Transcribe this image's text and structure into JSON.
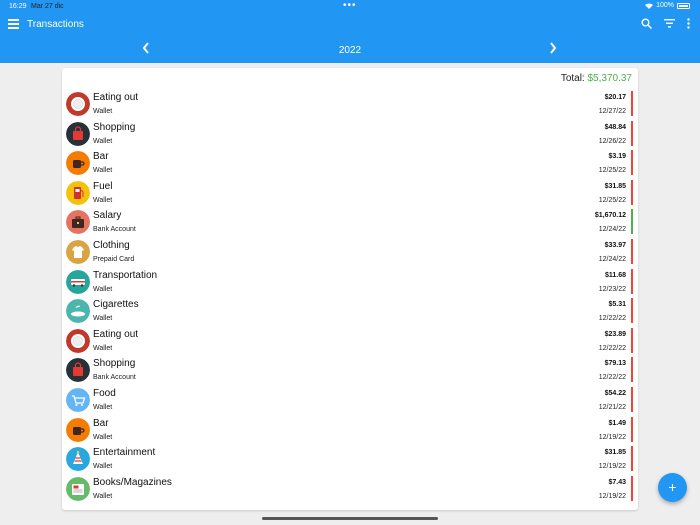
{
  "status": {
    "time": "16:29",
    "date": "Mar 27 dic",
    "battery": "100%"
  },
  "appbar": {
    "title": "Transactions"
  },
  "year": "2022",
  "total": {
    "label": "Total:",
    "amount": "$5,370.37"
  },
  "colors": {
    "primary": "#2196f3",
    "expense": "#f44336",
    "income": "#4caf50"
  },
  "transactions": [
    {
      "category": "Eating out",
      "account": "Wallet",
      "amount": "$20.17",
      "date": "12/27/22",
      "type": "expense",
      "icon": "plate-icon",
      "icon_color": "#c0392b"
    },
    {
      "category": "Shopping",
      "account": "Wallet",
      "amount": "$48.84",
      "date": "12/26/22",
      "type": "expense",
      "icon": "shopping-bag-icon",
      "icon_color": "#263238"
    },
    {
      "category": "Bar",
      "account": "Wallet",
      "amount": "$3.19",
      "date": "12/25/22",
      "type": "expense",
      "icon": "coffee-cup-icon",
      "icon_color": "#f57c00"
    },
    {
      "category": "Fuel",
      "account": "Wallet",
      "amount": "$31.85",
      "date": "12/25/22",
      "type": "expense",
      "icon": "fuel-pump-icon",
      "icon_color": "#f4c20d"
    },
    {
      "category": "Salary",
      "account": "Bank Account",
      "amount": "$1,670.12",
      "date": "12/24/22",
      "type": "income",
      "icon": "briefcase-icon",
      "icon_color": "#e5735f"
    },
    {
      "category": "Clothing",
      "account": "Prepaid Card",
      "amount": "$33.97",
      "date": "12/24/22",
      "type": "expense",
      "icon": "shirt-icon",
      "icon_color": "#d9a441"
    },
    {
      "category": "Transportation",
      "account": "Wallet",
      "amount": "$11.68",
      "date": "12/23/22",
      "type": "expense",
      "icon": "bus-icon",
      "icon_color": "#26a69a"
    },
    {
      "category": "Cigarettes",
      "account": "Wallet",
      "amount": "$5.31",
      "date": "12/22/22",
      "type": "expense",
      "icon": "ashtray-icon",
      "icon_color": "#4db6ac"
    },
    {
      "category": "Eating out",
      "account": "Wallet",
      "amount": "$23.89",
      "date": "12/22/22",
      "type": "expense",
      "icon": "plate-icon",
      "icon_color": "#c0392b"
    },
    {
      "category": "Shopping",
      "account": "Bank Account",
      "amount": "$79.13",
      "date": "12/22/22",
      "type": "expense",
      "icon": "shopping-bag-icon",
      "icon_color": "#263238"
    },
    {
      "category": "Food",
      "account": "Wallet",
      "amount": "$54.22",
      "date": "12/21/22",
      "type": "expense",
      "icon": "cart-icon",
      "icon_color": "#64b5f6"
    },
    {
      "category": "Bar",
      "account": "Wallet",
      "amount": "$1.49",
      "date": "12/19/22",
      "type": "expense",
      "icon": "coffee-cup-icon",
      "icon_color": "#f57c00"
    },
    {
      "category": "Entertainment",
      "account": "Wallet",
      "amount": "$31.85",
      "date": "12/19/22",
      "type": "expense",
      "icon": "party-hat-icon",
      "icon_color": "#29a8e0"
    },
    {
      "category": "Books/Magazines",
      "account": "Wallet",
      "amount": "$7.43",
      "date": "12/19/22",
      "type": "expense",
      "icon": "newspaper-icon",
      "icon_color": "#66bb6a"
    }
  ]
}
